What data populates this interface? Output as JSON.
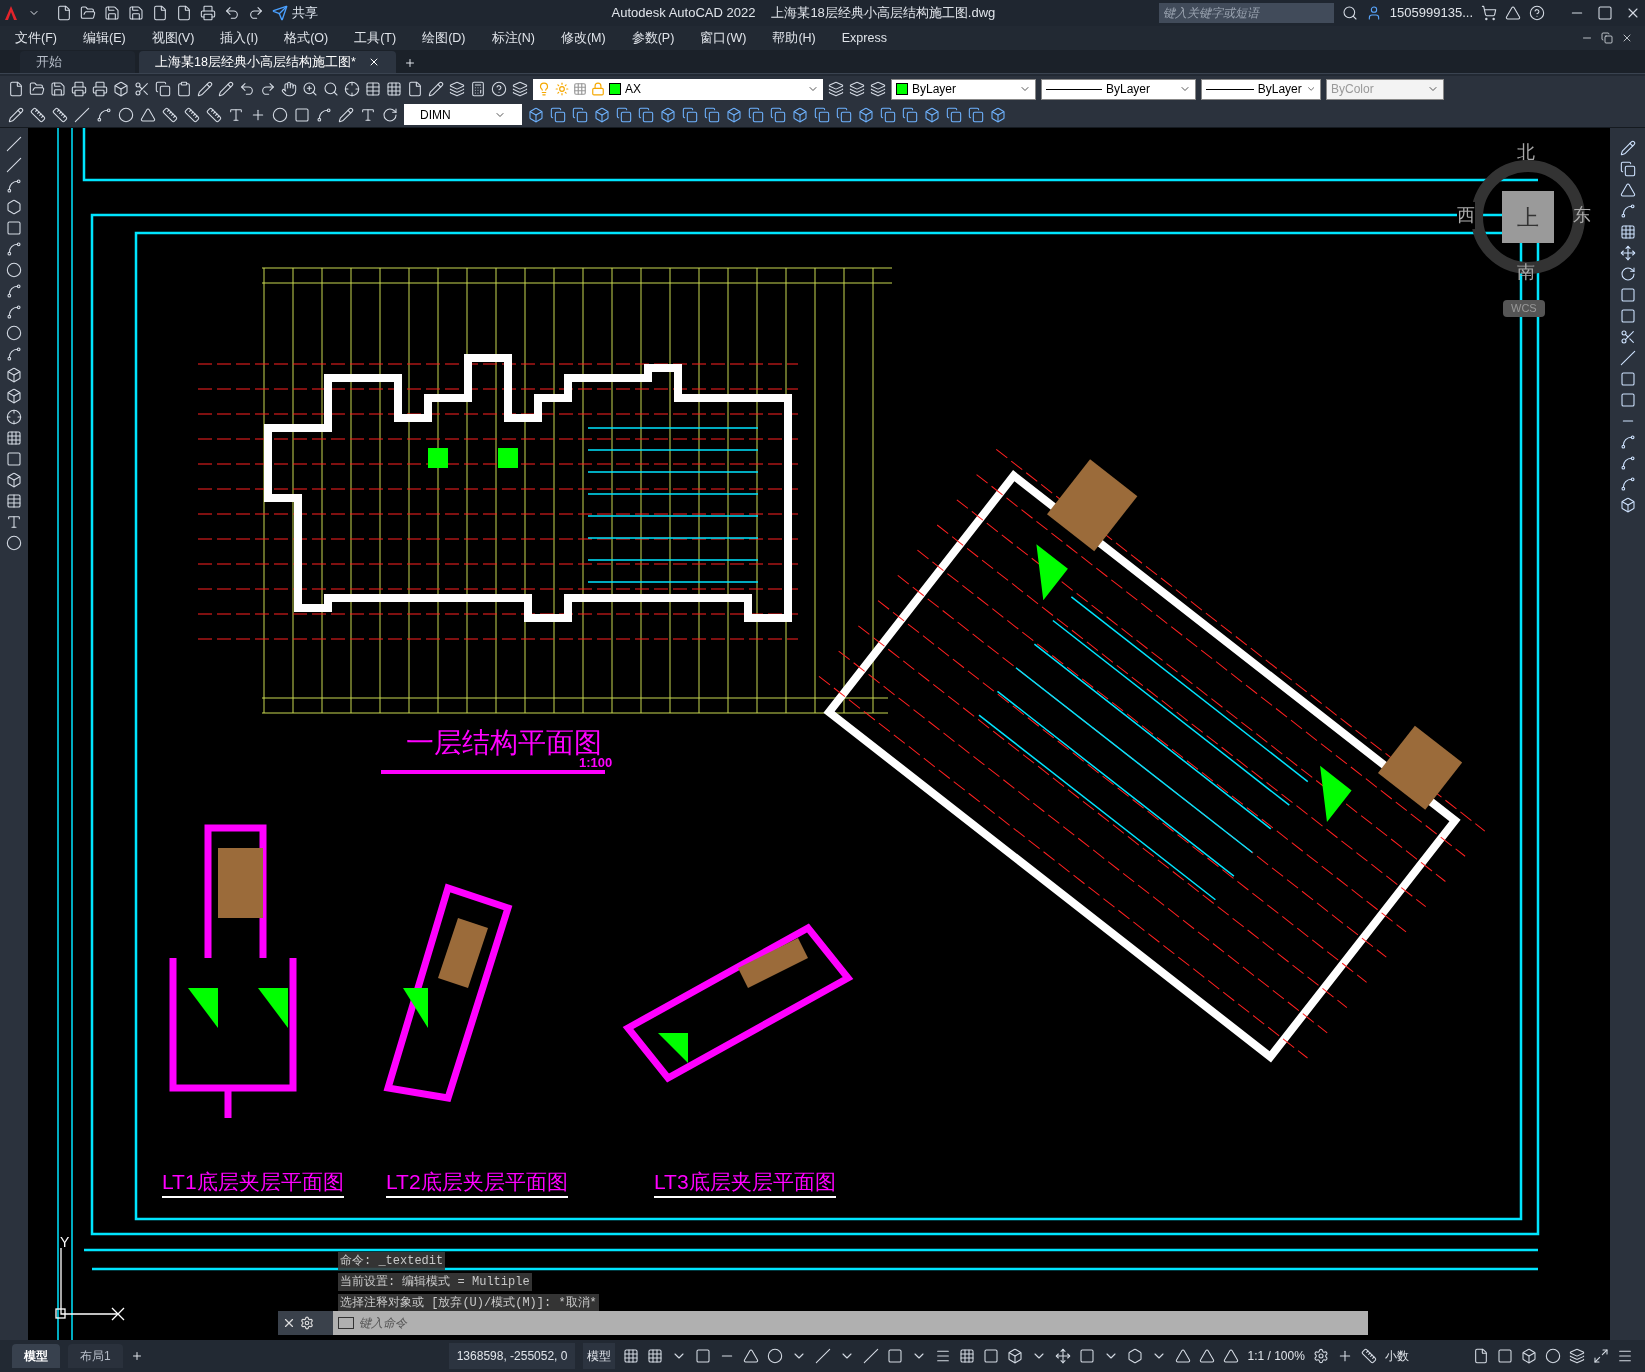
{
  "title_bar": {
    "share": "共享",
    "app_title": "Autodesk AutoCAD 2022",
    "file_title": "上海某18层经典小高层结构施工图.dwg",
    "search_placeholder": "键入关键字或短语",
    "user": "1505999135..."
  },
  "menu": [
    "文件(F)",
    "编辑(E)",
    "视图(V)",
    "插入(I)",
    "格式(O)",
    "工具(T)",
    "绘图(D)",
    "标注(N)",
    "修改(M)",
    "参数(P)",
    "窗口(W)",
    "帮助(H)",
    "Express"
  ],
  "tabs": [
    {
      "label": "开始",
      "selected": false
    },
    {
      "label": "上海某18层经典小高层结构施工图*",
      "selected": true
    }
  ],
  "properties": {
    "layer": "AX",
    "dim_style": "DIMN",
    "color_setting": "ByLayer",
    "linetype": "ByLayer",
    "lineweight": "ByLayer",
    "plot_style": {
      "label": "ByColor",
      "disabled": true
    }
  },
  "viewcube": {
    "north": "北",
    "west": "西",
    "east": "东",
    "south": "南",
    "face": "上",
    "wcs": "WCS"
  },
  "drawing": {
    "main_title": "一层结构平面图",
    "scale": "1:100",
    "sub_titles": [
      "LT1底层夹层平面图",
      "LT2底层夹层平面图",
      "LT3底层夹层平面图"
    ]
  },
  "ucs": {
    "y_axis": "Y"
  },
  "command_history": [
    "命令:  _textedit",
    "当前设置: 编辑模式 = Multiple",
    "选择注释对象或 [放弃(U)/模式(M)]: *取消*"
  ],
  "command_placeholder": "键入命令",
  "layout_tabs": [
    {
      "label": "模型",
      "selected": true
    },
    {
      "label": "布局1",
      "selected": false
    }
  ],
  "status_bar": {
    "coordinates": "1368598, -255052, 0",
    "space": "模型",
    "annotation_scale": "1:1 / 100%",
    "units": "小数"
  }
}
